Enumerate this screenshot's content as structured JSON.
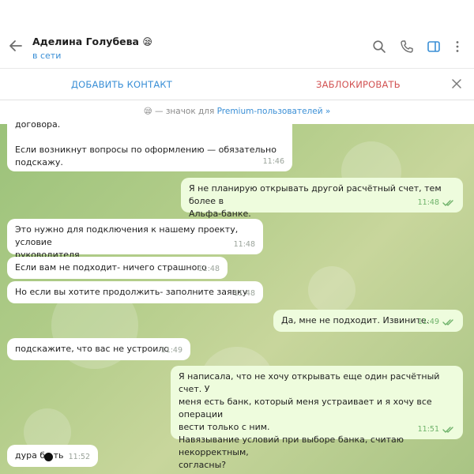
{
  "header": {
    "contact_name": "Аделина Голубева",
    "contact_emoji": "😪",
    "status": "в сети",
    "icons": [
      "back-arrow-icon",
      "search-icon",
      "phone-icon",
      "sidebar-toggle-icon",
      "more-vertical-icon"
    ],
    "status_color": "#3a8fd6"
  },
  "action_bar": {
    "add_contact": "ДОБАВИТЬ КОНТАКТ",
    "block": "ЗАБЛОКИРОВАТЬ",
    "close_icon": "close-icon"
  },
  "premium_notice": {
    "emoji": "😪",
    "prefix": "— значок для ",
    "link": "Premium-пользователей »"
  },
  "messages": [
    {
      "id": "m1",
      "direction": "in",
      "text": "договора.\n\nЕсли возникнут вопросы по оформлению — обязательно\nподскажу.",
      "time": "11:46"
    },
    {
      "id": "m2",
      "direction": "out",
      "text": "Я не планирую открывать другой расчётный счет, тем более в\nАльфа-банке.",
      "time": "11:48",
      "read": true
    },
    {
      "id": "m3",
      "direction": "in",
      "text": "Это нужно для подключения к нашему проекту, условие\nруководителя",
      "time": "11:48"
    },
    {
      "id": "m4",
      "direction": "in",
      "text": "Если вам не подходит- ничего страшного",
      "time": "11:48"
    },
    {
      "id": "m5",
      "direction": "in",
      "text": "Но если вы хотите продолжить- заполните заявку",
      "time": "11:48"
    },
    {
      "id": "m6",
      "direction": "out",
      "text": "Да, мне не подходит. Извините.",
      "time": "11:49",
      "read": true
    },
    {
      "id": "m7",
      "direction": "in",
      "text": "подскажите, что вас не устроило",
      "time": "11:49"
    },
    {
      "id": "m8",
      "direction": "out",
      "text": "Я написала, что не хочу открывать еще один расчётный счет. У\nменя есть банк, который меня устраивает и я хочу все операции\nвести только с ним.\nНавязывание условий при выборе банка, считаю некорректным,\nсогласны?",
      "time": "11:51",
      "read": true
    },
    {
      "id": "m9",
      "direction": "in",
      "text": "дура бл ть",
      "time": "11:52"
    }
  ],
  "colors": {
    "accent": "#3a8fd6",
    "danger": "#d25353",
    "incoming_bubble": "#ffffff",
    "outgoing_bubble": "#eefcdd",
    "read_ticks": "#6eb26a"
  }
}
